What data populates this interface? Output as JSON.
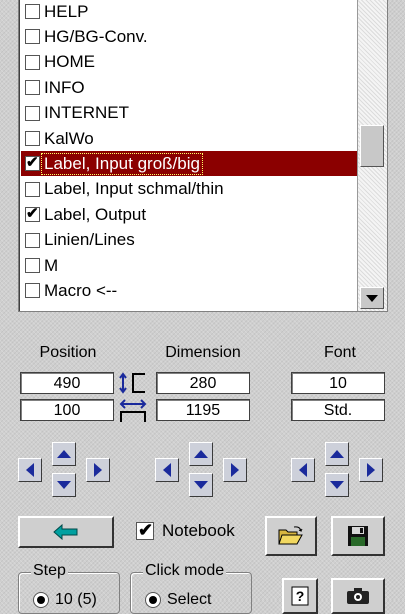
{
  "list": {
    "items": [
      {
        "label": "HELP",
        "checked": false,
        "selected": false
      },
      {
        "label": "HG/BG-Conv.",
        "checked": false,
        "selected": false
      },
      {
        "label": "HOME",
        "checked": false,
        "selected": false
      },
      {
        "label": "INFO",
        "checked": false,
        "selected": false
      },
      {
        "label": "INTERNET",
        "checked": false,
        "selected": false
      },
      {
        "label": "KalWo",
        "checked": false,
        "selected": false
      },
      {
        "label": "Label, Input groß/big",
        "checked": true,
        "selected": true
      },
      {
        "label": "Label, Input schmal/thin",
        "checked": false,
        "selected": false
      },
      {
        "label": "Label, Output",
        "checked": true,
        "selected": false
      },
      {
        "label": "Linien/Lines",
        "checked": false,
        "selected": false
      },
      {
        "label": "M",
        "checked": false,
        "selected": false
      },
      {
        "label": "Macro <--",
        "checked": false,
        "selected": false
      }
    ],
    "check_glyph": "✔"
  },
  "position": {
    "label": "Position",
    "x": "490",
    "y": "100"
  },
  "dimension": {
    "label": "Dimension",
    "w": "280",
    "h": "1195"
  },
  "font": {
    "label": "Font",
    "size": "10",
    "style": "Std."
  },
  "notebook": {
    "label": "Notebook",
    "checked": true,
    "check_glyph": "✔"
  },
  "step": {
    "label": "Step",
    "option": "10 (5)"
  },
  "click_mode": {
    "label": "Click mode",
    "option": "Select"
  },
  "icons": {
    "back": "arrow-left-icon",
    "open": "folder-open-icon",
    "save": "floppy-disk-icon",
    "help": "question-mark-icon",
    "capture": "camera-icon",
    "link_position_dimension": "position-dimension-link-icon"
  },
  "colors": {
    "selection": "#8b0000",
    "arrow": "#1a2a9c",
    "back_arrow": "#00a0a0",
    "panel": "#cfcfcf"
  }
}
